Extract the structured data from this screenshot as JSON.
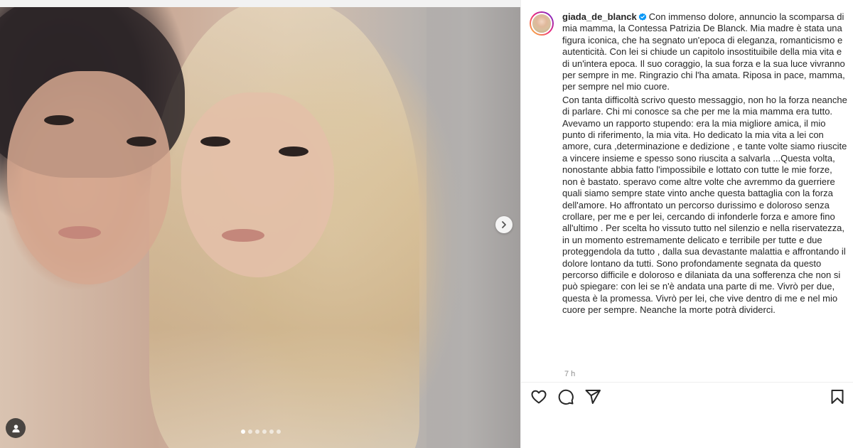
{
  "post": {
    "username": "giada_de_blanck",
    "caption_p1": "Con immenso dolore, annuncio la scomparsa di mia mamma, la Contessa Patrizia De Blanck. Mia madre è stata una figura iconica, che ha segnato un'epoca di eleganza, romanticismo e autenticità. Con lei si chiude un capitolo insostituibile della mia vita e di un'intera epoca. Il suo coraggio, la sua forza e la sua luce vivranno per sempre in me. Ringrazio chi l'ha amata. Riposa in pace, mamma, per sempre nel mio cuore.",
    "caption_p2": "Con tanta difficoltà scrivo questo messaggio, non ho la forza neanche di parlare. Chi mi conosce sa che per me la mia mamma era tutto. Avevamo un rapporto stupendo: era la mia migliore amica, il mio punto di riferimento, la mia vita. Ho dedicato la mia vita a lei con amore, cura ,determinazione e dedizione , e tante volte siamo riuscite a vincere insieme e spesso sono riuscita a salvarla ...Questa volta, nonostante abbia fatto l'impossibile e lottato con tutte le mie forze, non è bastato. speravo come altre volte che avremmo da guerriere quali siamo sempre state vinto anche questa battaglia con la forza dell'amore. Ho affrontato un percorso durissimo e doloroso senza crollare, per me e per lei, cercando di infonderle forza e amore fino all'ultimo . Per scelta ho vissuto tutto nel silenzio e nella riservatezza, in un momento estremamente delicato e terribile per tutte e due proteggendola da tutto , dalla sua devastante malattia e affrontando il dolore lontano da tutti. Sono profondamente segnata da questo percorso difficile e doloroso e dilaniata da una sofferenza che non si può spiegare: con lei se n'è andata una parte di me. Vivrò per due, questa è la promessa. Vivrò per lei, che vive dentro di me e nel mio cuore per sempre. Neanche la morte potrà dividerci.",
    "timestamp": "7 h"
  },
  "carousel": {
    "slide_count": 6,
    "active_index": 0
  },
  "icons": {
    "verified": "verified-badge-icon",
    "like": "heart-icon",
    "comment": "comment-icon",
    "share": "share-icon",
    "save": "bookmark-icon",
    "next": "chevron-right-icon",
    "tag": "user-tag-icon"
  },
  "colors": {
    "verified_blue": "#0095f6",
    "text": "#262626",
    "muted": "#8e8e8e"
  }
}
